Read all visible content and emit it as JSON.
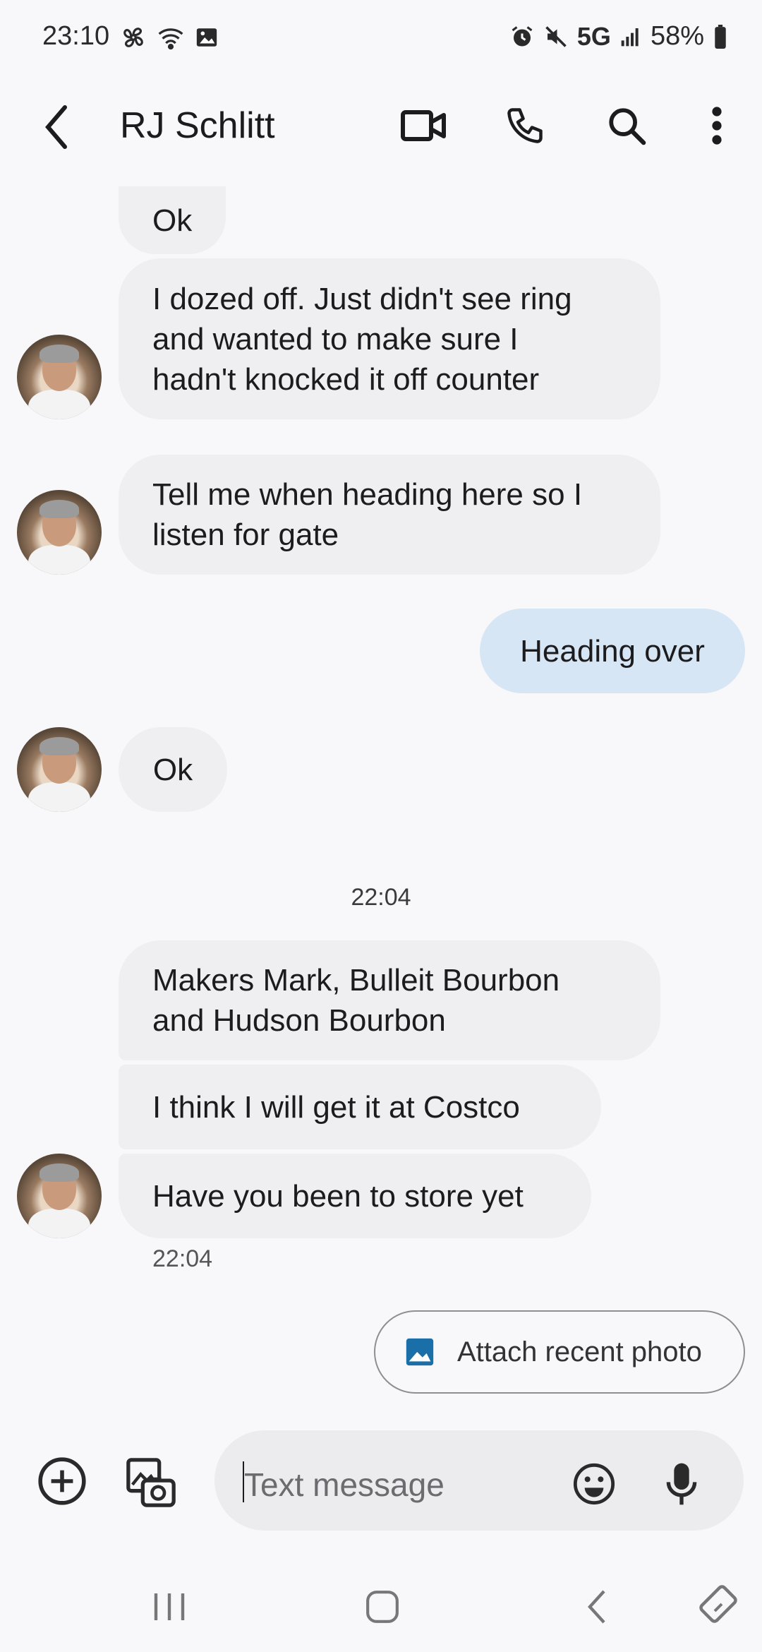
{
  "status_bar": {
    "time": "23:10",
    "network": "5G",
    "battery": "58%",
    "left_icons": [
      "fan-icon",
      "wifi-icon",
      "image-icon"
    ],
    "right_icons": [
      "alarm-icon",
      "mute-icon",
      "signal-icon",
      "battery-icon"
    ]
  },
  "header": {
    "contact_name": "RJ Schlitt",
    "actions": [
      "video-call-icon",
      "phone-icon",
      "search-icon",
      "more-icon"
    ]
  },
  "messages": [
    {
      "direction": "in",
      "text": "Ok"
    },
    {
      "direction": "in",
      "lines": [
        "I dozed off. Just didn't see ring",
        "and wanted to make sure I",
        "hadn't knocked it off counter"
      ]
    },
    {
      "direction": "in",
      "lines": [
        "Tell me when heading here so I",
        "listen for gate"
      ]
    },
    {
      "direction": "out",
      "text": "Heading over"
    },
    {
      "direction": "in",
      "text": "Ok"
    },
    {
      "direction": "in",
      "lines": [
        "Makers Mark, Bulleit Bourbon",
        "and Hudson Bourbon"
      ]
    },
    {
      "direction": "in",
      "text": "I think I will get it at Costco"
    },
    {
      "direction": "in",
      "text": "Have you been to store yet"
    }
  ],
  "timestamps": {
    "divider": "22:04",
    "last_message": "22:04"
  },
  "attach_chip": {
    "label": "Attach recent photo"
  },
  "composer": {
    "placeholder": "Text message"
  },
  "colors": {
    "incoming_bubble": "#efeff1",
    "outgoing_bubble": "#d6e6f4",
    "attach_icon": "#1a6fa8"
  }
}
